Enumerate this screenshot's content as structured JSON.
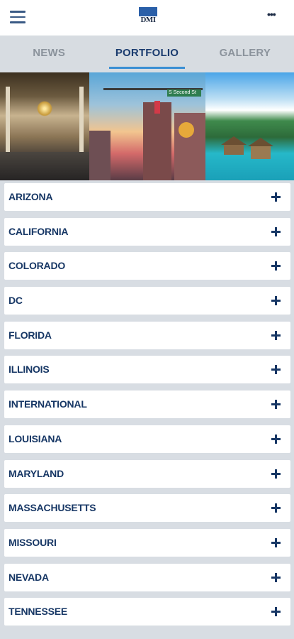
{
  "header": {
    "logo_text": "DMI",
    "menu_icon": "hamburger-menu-icon",
    "more_icon": "more-horizontal-icon",
    "more_glyph": "•••"
  },
  "tabs": [
    {
      "label": "NEWS",
      "active": false
    },
    {
      "label": "PORTFOLIO",
      "active": true
    },
    {
      "label": "GALLERY",
      "active": false
    }
  ],
  "banner": {
    "street_sign": "S Second St"
  },
  "locations": [
    {
      "label": "ARIZONA"
    },
    {
      "label": "CALIFORNIA"
    },
    {
      "label": "COLORADO"
    },
    {
      "label": "DC"
    },
    {
      "label": "FLORIDA"
    },
    {
      "label": "ILLINOIS"
    },
    {
      "label": "INTERNATIONAL"
    },
    {
      "label": "LOUISIANA"
    },
    {
      "label": "MARYLAND"
    },
    {
      "label": "MASSACHUSETTS"
    },
    {
      "label": "MISSOURI"
    },
    {
      "label": "NEVADA"
    },
    {
      "label": "TENNESSEE"
    }
  ],
  "colors": {
    "accent": "#3a8fd4",
    "text_dark": "#173765",
    "tab_inactive": "#8b939c",
    "background": "#d8dde3"
  }
}
